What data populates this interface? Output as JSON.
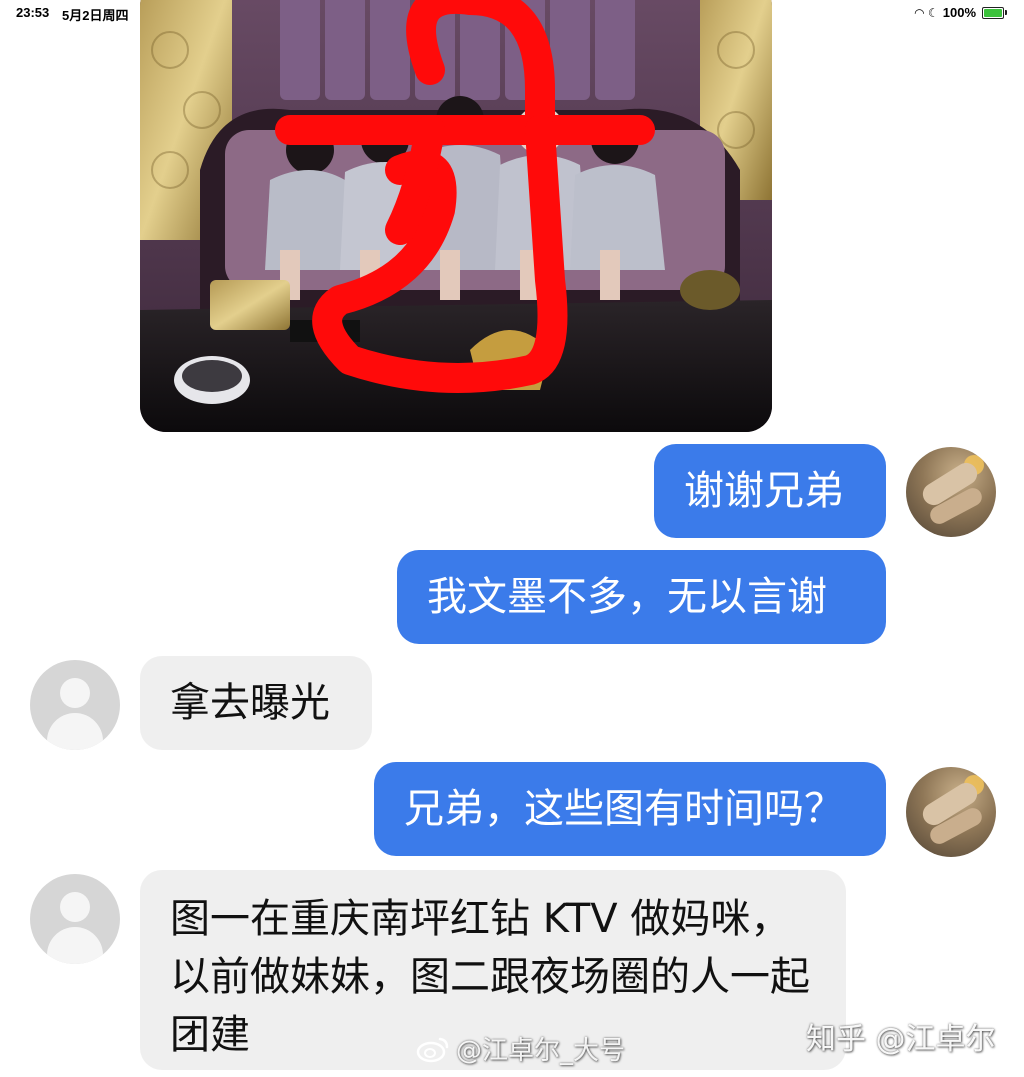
{
  "status_bar": {
    "time": "23:53",
    "date": "5月2日周四",
    "battery": "100%",
    "icons": [
      "wifi-icon",
      "moon-icon",
      "battery-charging-icon"
    ]
  },
  "photo": {
    "kind": "shared-photo",
    "overlay_color": "#ff0000"
  },
  "messages": [
    {
      "side": "outgoing",
      "text": "谢谢兄弟"
    },
    {
      "side": "outgoing",
      "text": "我文墨不多，无以言谢"
    },
    {
      "side": "incoming",
      "text": "拿去曝光"
    },
    {
      "side": "outgoing",
      "text": "兄弟，这些图有时间吗？"
    },
    {
      "side": "incoming",
      "text": "图一在重庆南坪红钻 KTV 做妈咪，以前做妹妹，图二跟夜场圈的人一起团建"
    }
  ],
  "watermarks": {
    "weibo": "@江卓尔_大号",
    "zhihu": "知乎 @江卓尔"
  },
  "colors": {
    "outgoing_bubble": "#3b7bea",
    "incoming_bubble": "#efefef",
    "background": "#ffffff"
  }
}
